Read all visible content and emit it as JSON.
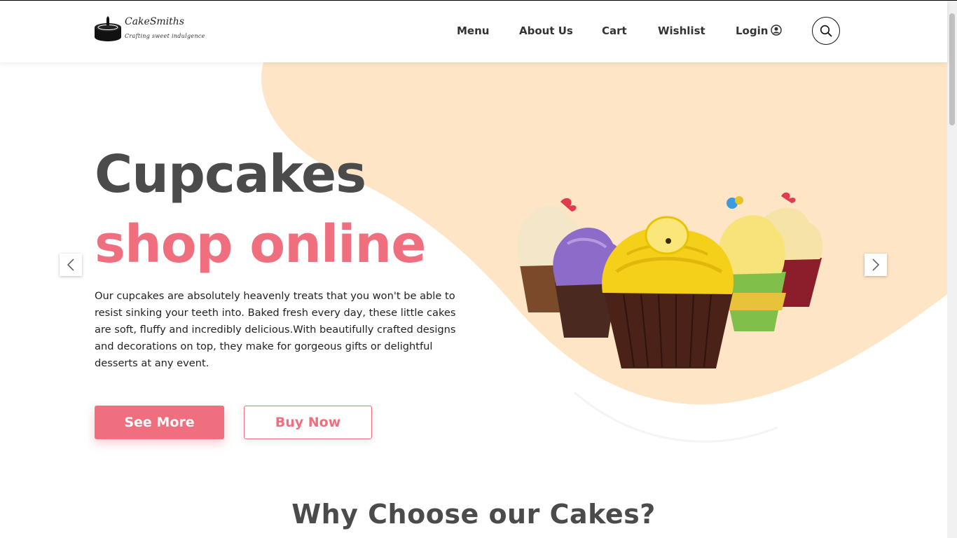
{
  "brand": {
    "name": "CakeSmiths",
    "tagline": "Crafting sweet indulgence"
  },
  "nav": {
    "items": [
      {
        "label": "Menu"
      },
      {
        "label": "About Us"
      },
      {
        "label": "Cart"
      },
      {
        "label": "Wishlist"
      },
      {
        "label": "Login"
      }
    ]
  },
  "hero": {
    "title_line1": "Cupcakes",
    "title_line2": "shop online",
    "description": "Our cupcakes are absolutely heavenly treats that you won't be able to resist sinking your teeth into. Baked fresh every day, these little cakes are soft, fluffy and incredibly delicious.With beautifully crafted designs and decorations on top, they make for gorgeous gifts or delightful desserts at any event.",
    "primary_button": "See More",
    "secondary_button": "Buy Now"
  },
  "section": {
    "title": "Why Choose our Cakes?"
  },
  "colors": {
    "accent": "#f06f7f",
    "heading": "#4b4b4b",
    "blob": "#fde5c6"
  },
  "icons": {
    "search": "search-icon",
    "user": "user-circle-icon",
    "prev": "chevron-left-icon",
    "next": "chevron-right-icon"
  }
}
